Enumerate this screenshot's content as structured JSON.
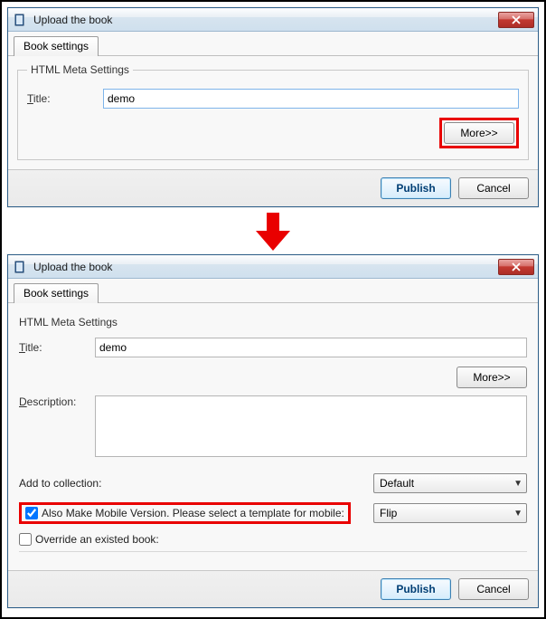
{
  "dialog1": {
    "title": "Upload the book",
    "tab": "Book settings",
    "legend": "HTML Meta Settings",
    "titleLabelPrefix": "T",
    "titleLabelRest": "itle:",
    "titleValue": "demo",
    "more": "More>>",
    "publish": "Publish",
    "cancel": "Cancel"
  },
  "dialog2": {
    "title": "Upload the book",
    "tab": "Book settings",
    "legend": "HTML Meta Settings",
    "titleLabelPrefix": "T",
    "titleLabelRest": "itle:",
    "titleValue": "demo",
    "more": "More>>",
    "descLabelPrefix": "D",
    "descLabelRest": "escription:",
    "descValue": "",
    "collectionLabelPrefix": "A",
    "collectionLabelRest": "dd to collection:",
    "collectionValue": "Default",
    "mobileLabelPrefix": "A",
    "mobileLabelRest": "lso Make Mobile Version. Please select a template for mobile:",
    "mobileChecked": true,
    "mobileTemplate": "Flip",
    "overrideLabelPrefix": "O",
    "overrideLabelRest": "verride an existed book:",
    "overrideChecked": false,
    "publish": "Publish",
    "cancel": "Cancel"
  }
}
